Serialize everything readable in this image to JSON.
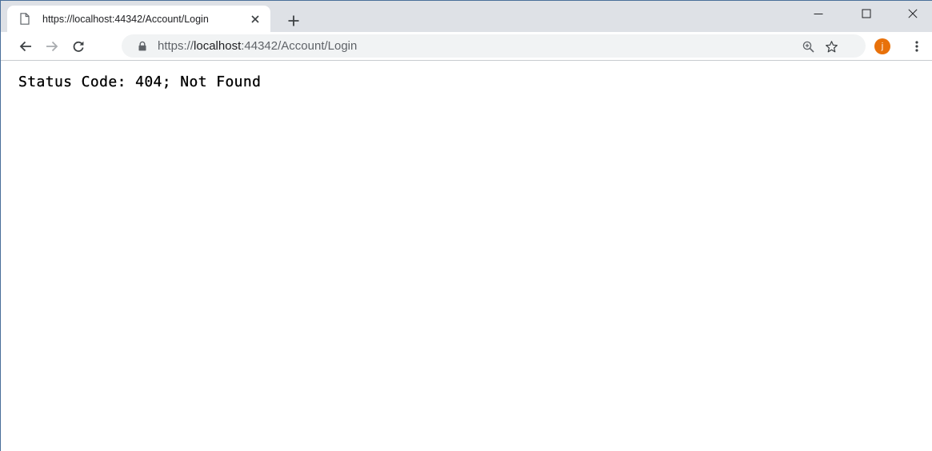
{
  "tab": {
    "title": "https://localhost:44342/Account/Login",
    "favicon": "page-icon",
    "close_icon": "close-icon"
  },
  "new_tab_icon": "plus-icon",
  "window_controls": {
    "minimize_icon": "minimize-icon",
    "maximize_icon": "maximize-icon",
    "close_icon": "close-icon"
  },
  "toolbar": {
    "back_icon": "back-arrow-icon",
    "forward_icon": "forward-arrow-icon",
    "reload_icon": "reload-icon",
    "zoom_icon": "zoom-icon",
    "star_icon": "star-icon",
    "menu_icon": "vertical-dots-icon"
  },
  "omnibox": {
    "lock_icon": "lock-icon",
    "scheme": "https://",
    "host": "localhost",
    "path": ":44342/Account/Login"
  },
  "profile": {
    "initial": "j",
    "color": "#e8710a"
  },
  "page": {
    "status": "Status Code: 404; Not Found"
  }
}
